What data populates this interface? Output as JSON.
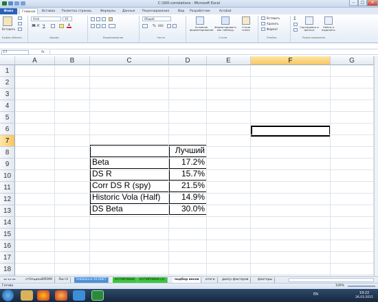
{
  "window": {
    "title": "C:\\300-correlations - Microsoft Excel"
  },
  "menu": {
    "tabs": [
      "Файл",
      "Главная",
      "Вставка",
      "Разметка страниц",
      "Формулы",
      "Данные",
      "Рецензирование",
      "Вид",
      "Разработчик",
      "Acrobat"
    ]
  },
  "ribbon": {
    "paste_label": "Вставить",
    "font_name": "Arial",
    "font_size": "10",
    "number_format": "Общий",
    "percent_symbol": "%",
    "thousands_symbol": "000",
    "cond_format_label": "Условное форматирование",
    "format_table_label": "Форматировать как таблицу",
    "cell_styles_label": "Стили ячеек",
    "insert_label": "Вставить",
    "delete_label": "Удалить",
    "format_label": "Формат",
    "sort_label": "Сортировка и фильтр",
    "find_label": "Найти и выделить",
    "groups": [
      "Буфер обмена",
      "Шрифт",
      "Выравнивание",
      "Число",
      "Стили",
      "Ячейки",
      "Редактирование"
    ]
  },
  "formula_bar": {
    "name_box": "F7",
    "fx": "fx",
    "content": ""
  },
  "columns": [
    "A",
    "B",
    "C",
    "D",
    "E",
    "F",
    "G"
  ],
  "rows": [
    "1",
    "2",
    "3",
    "4",
    "5",
    "6",
    "7",
    "8",
    "9",
    "10",
    "11",
    "12",
    "13",
    "14",
    "15",
    "16",
    "17",
    "18",
    "19"
  ],
  "selected_cell": "F7",
  "table": {
    "header": "Лучший",
    "rows": [
      {
        "label": "Beta",
        "value": "17.2%"
      },
      {
        "label": "DS R",
        "value": "15.7%"
      },
      {
        "label": "Corr DS R (spy)",
        "value": "21.5%"
      },
      {
        "label": "Historic Vola (Half)",
        "value": "14.9%"
      },
      {
        "label": "DS Beta",
        "value": "30.0%"
      }
    ]
  },
  "sheets": [
    "стОпционВРЕМЯ",
    "Лист2",
    "imbalance-10.00ET",
    "КОТИРОВКИ",
    "КОТИРОВКИ (2)",
    "подбор весов",
    "итоги",
    "диагр факторов",
    "факторы"
  ],
  "active_sheet": "подбор весов",
  "status": {
    "ready": "Готово",
    "zoom": "100%"
  },
  "taskbar": {
    "lang": "EN",
    "time": "19:22",
    "date": "26.03.2015"
  },
  "colors": {
    "accent": "#2a62b8",
    "selected_header": "#f8c560",
    "sheet_green": "#39c739",
    "sheet_blue": "#4a90d9"
  }
}
